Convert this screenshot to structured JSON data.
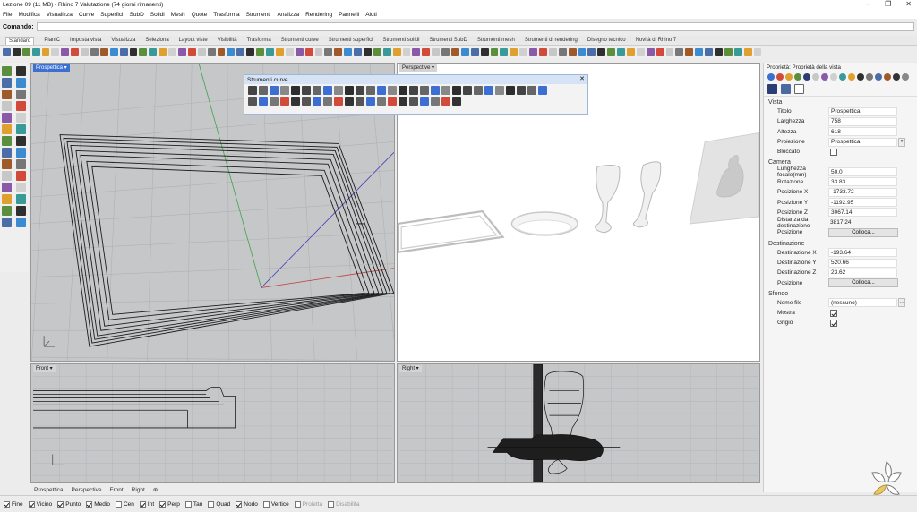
{
  "window": {
    "title": "Lezione 09 (11 MB) - Rhino 7 Valutazione (74 giorni rimanenti)"
  },
  "menu": [
    "File",
    "Modifica",
    "Visualizza",
    "Curve",
    "Superfici",
    "SubD",
    "Solidi",
    "Mesh",
    "Quote",
    "Trasforma",
    "Strumenti",
    "Analizza",
    "Rendering",
    "Pannelli",
    "Aiuti"
  ],
  "command": {
    "label": "Comando:",
    "value": ""
  },
  "toolbar_tabs": [
    "Standard",
    "PianiC",
    "Imposta vista",
    "Visualizza",
    "Seleziona",
    "Layout viste",
    "Visibilità",
    "Trasforma",
    "Strumenti curve",
    "Strumenti superfici",
    "Strumenti solidi",
    "Strumenti SubD",
    "Strumenti mesh",
    "Strumenti di rendering",
    "Disegno tecnico",
    "Novità di Rhino 7"
  ],
  "active_tab": "Standard",
  "viewports": {
    "perspective_left": "Prospettica",
    "perspective_right": "Perspective",
    "front": "Front",
    "right": "Right"
  },
  "floating_toolbar": {
    "title": "Strumenti curve"
  },
  "viewport_tabs": [
    "Prospettica",
    "Perspective",
    "Front",
    "Right"
  ],
  "osnaps": [
    {
      "label": "Fine",
      "on": true
    },
    {
      "label": "Vicino",
      "on": true
    },
    {
      "label": "Punto",
      "on": true
    },
    {
      "label": "Medio",
      "on": true
    },
    {
      "label": "Cen",
      "on": false
    },
    {
      "label": "Int",
      "on": true
    },
    {
      "label": "Perp",
      "on": true
    },
    {
      "label": "Tan",
      "on": false
    },
    {
      "label": "Quad",
      "on": false
    },
    {
      "label": "Nodo",
      "on": true
    },
    {
      "label": "Vertice",
      "on": false
    },
    {
      "label": "Proietta",
      "on": false,
      "dim": true
    },
    {
      "label": "Disabilita",
      "on": false,
      "dim": true
    }
  ],
  "properties": {
    "header": "Proprietà: Proprietà della vista",
    "vista": {
      "section": "Vista",
      "titolo_label": "Titolo",
      "titolo": "Prospettica",
      "larghezza_label": "Larghezza",
      "larghezza": "758",
      "altezza_label": "Altezza",
      "altezza": "618",
      "proiezione_label": "Proiezione",
      "proiezione": "Prospettica",
      "bloccato_label": "Bloccato",
      "bloccato": false
    },
    "camera": {
      "section": "Camera",
      "focale_label": "Lunghezza focale(mm)",
      "focale": "50.0",
      "rotazione_label": "Rotazione",
      "rotazione": "33.83",
      "posx_label": "Posizione X",
      "posx": "-1733.72",
      "posy_label": "Posizione Y",
      "posy": "-1192.95",
      "posz_label": "Posizione Z",
      "posz": "3067.14",
      "distanza_label": "Distanza da destinazione",
      "distanza": "3817.24",
      "posizione_label": "Posizione",
      "colloca": "Colloca..."
    },
    "destinazione": {
      "section": "Destinazione",
      "dx_label": "Destinazione X",
      "dx": "-193.64",
      "dy_label": "Destinazione Y",
      "dy": "520.66",
      "dz_label": "Destinazione Z",
      "dz": "23.62",
      "posizione_label": "Posizione",
      "colloca": "Colloca..."
    },
    "sfondo": {
      "section": "Sfondo",
      "nome_label": "Nome file",
      "nome": "(nessuno)",
      "mostra_label": "Mostra",
      "mostra": true,
      "grigio_label": "Grigio",
      "grigio": true
    }
  },
  "colors": {
    "accent": "#3c6fd1",
    "viewport_bg": "#c5c6c8",
    "grid": "#b3b4b6"
  }
}
